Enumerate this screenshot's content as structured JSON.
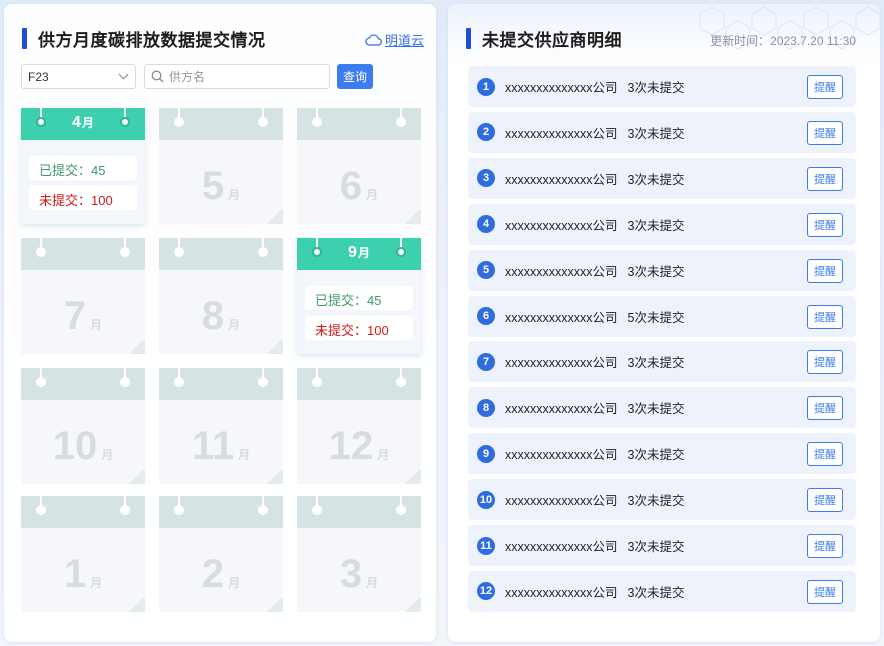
{
  "left_panel": {
    "title": "供方月度碳排放数据提交情况",
    "cloud_link": "明道云",
    "filter_select_value": "F23",
    "search_placeholder": "供方名",
    "query_button": "查询",
    "month_suffix": "月",
    "months": [
      {
        "num": "4",
        "active": true,
        "submitted": "已提交：45",
        "unsubmitted": "未提交：100"
      },
      {
        "num": "5",
        "active": false
      },
      {
        "num": "6",
        "active": false
      },
      {
        "num": "7",
        "active": false
      },
      {
        "num": "8",
        "active": false
      },
      {
        "num": "9",
        "active": true,
        "submitted": "已提交：45",
        "unsubmitted": "未提交：100"
      },
      {
        "num": "10",
        "active": false
      },
      {
        "num": "11",
        "active": false
      },
      {
        "num": "12",
        "active": false
      },
      {
        "num": "1",
        "active": false
      },
      {
        "num": "2",
        "active": false
      },
      {
        "num": "3",
        "active": false
      }
    ]
  },
  "right_panel": {
    "title": "未提交供应商明细",
    "update_time": "更新时间：2023.7.20 11:30",
    "remind_label": "提醒",
    "rows": [
      {
        "index": "1",
        "name": "xxxxxxxxxxxxxx公司",
        "count": "3次未提交"
      },
      {
        "index": "2",
        "name": "xxxxxxxxxxxxxx公司",
        "count": "3次未提交"
      },
      {
        "index": "3",
        "name": "xxxxxxxxxxxxxx公司",
        "count": "3次未提交"
      },
      {
        "index": "4",
        "name": "xxxxxxxxxxxxxx公司",
        "count": "3次未提交"
      },
      {
        "index": "5",
        "name": "xxxxxxxxxxxxxx公司",
        "count": "3次未提交"
      },
      {
        "index": "6",
        "name": "xxxxxxxxxxxxxx公司",
        "count": "5次未提交"
      },
      {
        "index": "7",
        "name": "xxxxxxxxxxxxxx公司",
        "count": "3次未提交"
      },
      {
        "index": "8",
        "name": "xxxxxxxxxxxxxx公司",
        "count": "3次未提交"
      },
      {
        "index": "9",
        "name": "xxxxxxxxxxxxxx公司",
        "count": "3次未提交"
      },
      {
        "index": "10",
        "name": "xxxxxxxxxxxxxx公司",
        "count": "3次未提交"
      },
      {
        "index": "11",
        "name": "xxxxxxxxxxxxxx公司",
        "count": "3次未提交"
      },
      {
        "index": "12",
        "name": "xxxxxxxxxxxxxx公司",
        "count": "3次未提交"
      }
    ]
  },
  "colors": {
    "accent": "#3b7cf0",
    "title_bar": "#1d4fd6",
    "active_header": "#3dd0ae",
    "submitted": "#3d9a6a",
    "unsubmitted": "#d01a1a"
  }
}
